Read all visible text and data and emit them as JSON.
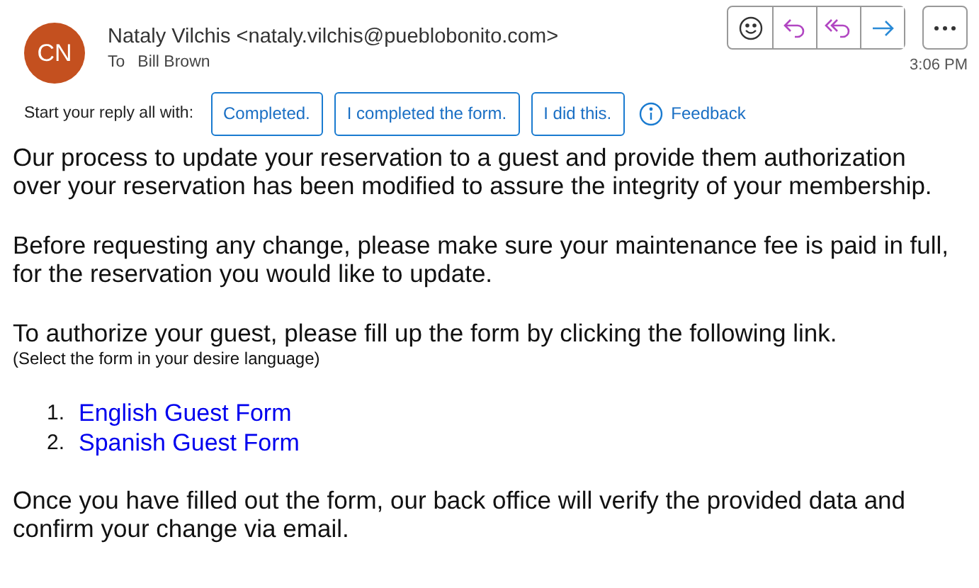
{
  "header": {
    "avatar": "CN",
    "sender": "Nataly Vilchis <nataly.vilchis@pueblobonito.com>",
    "to_label": "To",
    "recipient": "Bill Brown",
    "time": "3:06 PM",
    "actions": [
      {
        "kind": "emoji"
      },
      {
        "kind": "reply"
      },
      {
        "kind": "reply-all"
      },
      {
        "kind": "forward"
      },
      {
        "kind": "more"
      }
    ]
  },
  "suggestions": {
    "prompt": "Start your reply all with:",
    "chips": [
      "Completed.",
      "I completed the form.",
      "I did this."
    ],
    "feedback": "Feedback"
  },
  "body": [
    {
      "kind": "paragraph",
      "text": "Our process to update your reservation to a guest and provide them authorization over your reservation has been modified to assure the integrity of your membership."
    },
    {
      "kind": "paragraph",
      "text": "Before requesting any change, please make sure your maintenance fee is paid in full, for the reservation you would like to update."
    },
    {
      "kind": "paragraph",
      "text": "To authorize your guest, please fill up the form by clicking the following link."
    },
    {
      "kind": "note",
      "text": "(Select the form in your desire language)"
    },
    {
      "kind": "list",
      "items": [
        {
          "number": "1.",
          "text": "English Guest Form"
        },
        {
          "number": "2.",
          "text": "Spanish Guest Form"
        }
      ]
    },
    {
      "kind": "paragraph",
      "text": "Once you have filled out the form, our back office will verify the provided data and confirm your change via email."
    }
  ]
}
